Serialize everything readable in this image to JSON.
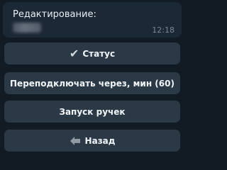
{
  "message": {
    "title": "Редактирование:",
    "time": "12:18"
  },
  "buttons": {
    "status": {
      "icon": "checkmark-icon",
      "icon_glyph": "✔",
      "label": "Статус"
    },
    "reconnect": {
      "label": "Переподключать через, мин (60)"
    },
    "launch": {
      "label": "Запуск ручек"
    },
    "back": {
      "icon": "back-arrow-icon",
      "label": "Назад"
    }
  },
  "colors": {
    "background": "#121a23",
    "bubble": "#1b2836",
    "button": "#2b3947",
    "text": "#f2f5f8",
    "time": "#7a8896"
  }
}
